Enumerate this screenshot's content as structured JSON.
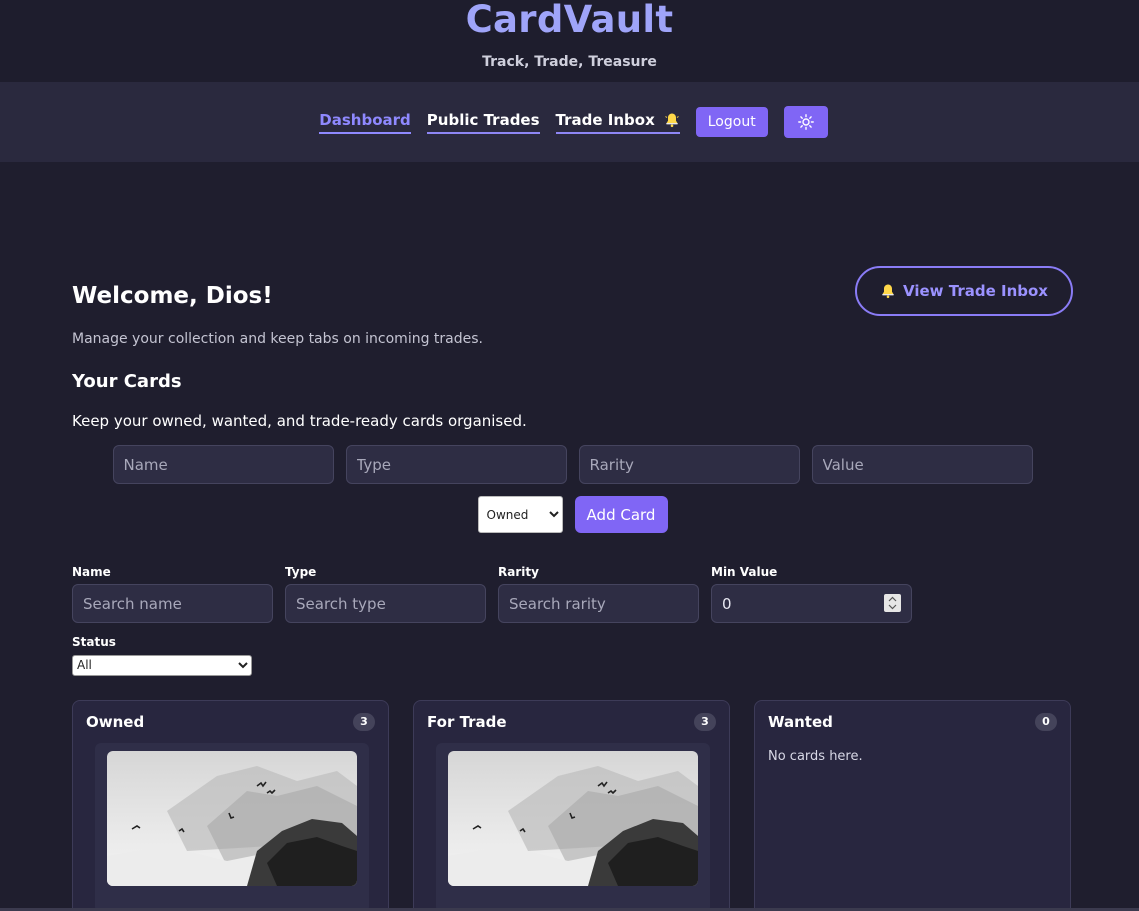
{
  "brand": {
    "title": "CardVault",
    "tagline": "Track, Trade, Treasure"
  },
  "nav": {
    "links": [
      {
        "label": "Dashboard"
      },
      {
        "label": "Public Trades"
      },
      {
        "label": "Trade Inbox"
      }
    ],
    "logout_label": "Logout"
  },
  "welcome": {
    "title": "Welcome, Dios!",
    "subtitle": "Manage your collection and keep tabs on incoming trades.",
    "inbox_button": "View Trade Inbox"
  },
  "cards_section": {
    "title": "Your Cards",
    "subtitle": "Keep your owned, wanted, and trade-ready cards organised."
  },
  "add_form": {
    "name_placeholder": "Name",
    "type_placeholder": "Type",
    "rarity_placeholder": "Rarity",
    "value_placeholder": "Value",
    "status_selected": "Owned",
    "add_button": "Add Card"
  },
  "filters": {
    "name_label": "Name",
    "name_placeholder": "Search name",
    "type_label": "Type",
    "type_placeholder": "Search type",
    "rarity_label": "Rarity",
    "rarity_placeholder": "Search rarity",
    "min_value_label": "Min Value",
    "min_value": "0",
    "status_label": "Status",
    "status_selected": "All"
  },
  "columns": [
    {
      "title": "Owned",
      "count": "3"
    },
    {
      "title": "For Trade",
      "count": "3"
    },
    {
      "title": "Wanted",
      "count": "0",
      "empty_text": "No cards here."
    }
  ],
  "colors": {
    "accent": "#8066f5",
    "brand": "#9fa4f9",
    "background": "#1f1e2e"
  }
}
